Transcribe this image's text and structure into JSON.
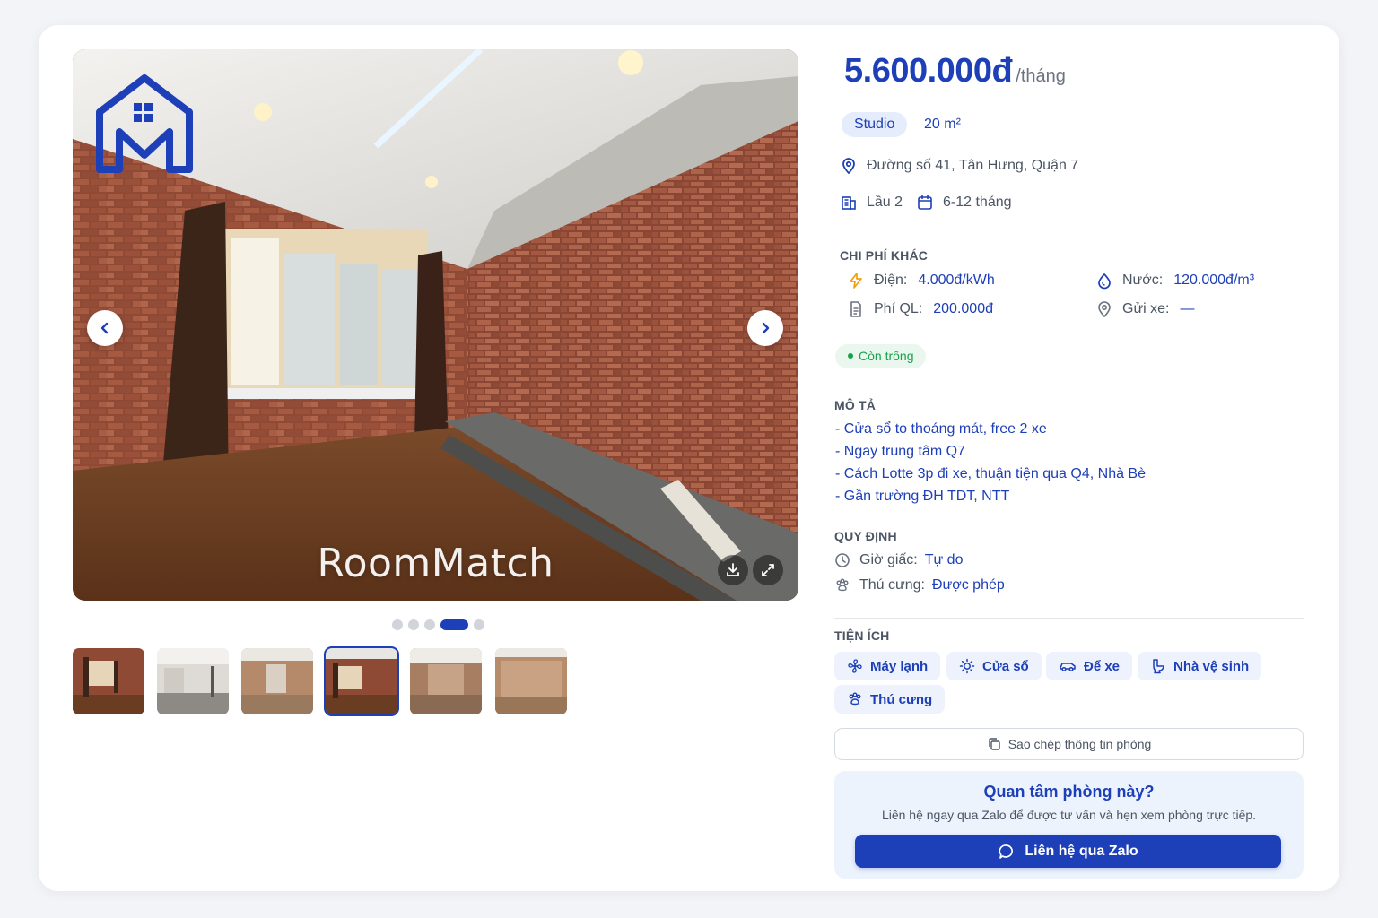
{
  "gallery": {
    "watermark": "RoomMatch",
    "total_images": 6,
    "active_index": 4,
    "thumbnails": [
      "thumb-1",
      "thumb-2",
      "thumb-3",
      "thumb-4",
      "thumb-5",
      "thumb-6"
    ]
  },
  "listing": {
    "price": "5.600.000đ",
    "price_unit": "/tháng",
    "type": "Studio",
    "area": "20 m²",
    "address": "Đường số 41, Tân Hưng, Quận 7",
    "floor": "Lầu 2",
    "lease": "6-12 tháng",
    "status": "Còn trống"
  },
  "fees": {
    "title": "CHI PHÍ KHÁC",
    "electric_label": "Điện:",
    "electric_value": "4.000đ/kWh",
    "water_label": "Nước:",
    "water_value": "120.000đ/m³",
    "mgmt_label": "Phí QL:",
    "mgmt_value": "200.000đ",
    "parking_label": "Gửi xe:",
    "parking_value": "—"
  },
  "description": {
    "title": "MÔ TẢ",
    "lines": [
      "- Cửa sổ to thoáng mát, free 2 xe",
      "- Ngay trung tâm Q7",
      "- Cách Lotte 3p đi xe, thuận tiện qua Q4, Nhà Bè",
      "- Gần trường ĐH TDT, NTT"
    ]
  },
  "rules": {
    "title": "QUY ĐỊNH",
    "hours_label": "Giờ giấc:",
    "hours_value": "Tự do",
    "pets_label": "Thú cưng:",
    "pets_value": "Được phép"
  },
  "amenities": {
    "title": "TIỆN ÍCH",
    "items": [
      "Máy lạnh",
      "Cửa sổ",
      "Để xe",
      "Nhà vệ sinh",
      "Thú cưng"
    ]
  },
  "actions": {
    "copy_label": "Sao chép thông tin phòng",
    "contact_title": "Quan tâm phòng này?",
    "contact_subtitle": "Liên hệ ngay qua Zalo để được tư vấn và hẹn xem phòng trực tiếp.",
    "zalo_label": "Liên hệ qua Zalo"
  },
  "colors": {
    "primary": "#1d3fb8",
    "status_green": "#16a34a",
    "chip_bg": "#e5ecfb"
  }
}
